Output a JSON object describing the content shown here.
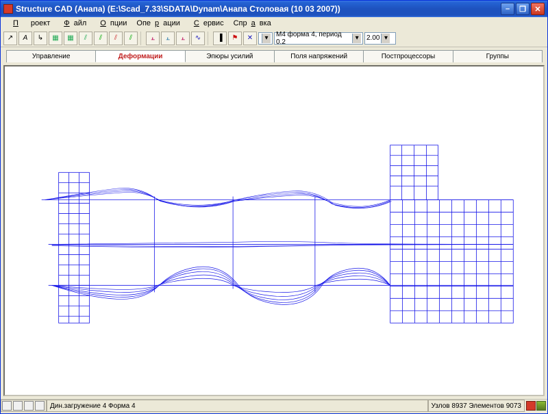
{
  "window": {
    "title": "Structure CAD (Анапа) (E:\\Scad_7.33\\SDATA\\Dynam\\Анапа Столовая (10 03 2007))"
  },
  "menu": {
    "project": "Проект",
    "file": "Файл",
    "options": "Опции",
    "operations": "Операции",
    "service": "Сервис",
    "help": "Справка"
  },
  "toolbar": {
    "dropdown1": "M4 форма 4, период 0.2",
    "dropdown2": "2.00"
  },
  "tabs": {
    "t1": "Управление",
    "t2": "Деформации",
    "t3": "Эпюры усилий",
    "t4": "Поля напряжений",
    "t5": "Постпроцессоры",
    "t6": "Группы"
  },
  "status": {
    "left": "Дин.загружение 4  Форма 4",
    "right": "Узлов 8937 Элементов 9073"
  }
}
